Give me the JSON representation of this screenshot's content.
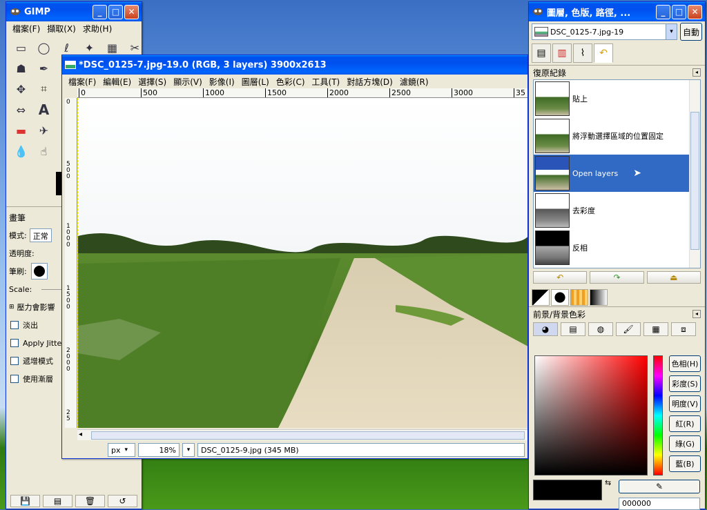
{
  "toolbox": {
    "title": "GIMP",
    "menu": [
      "檔案(F)",
      "擷取(X)",
      "求助(H)"
    ],
    "options_title": "畫筆",
    "mode_label": "模式:",
    "mode_value": "正常",
    "opacity_label": "透明度:",
    "brush_label": "筆刷:",
    "scale_label": "Scale:",
    "pressure_label": "壓力會影響",
    "fade_label": "淡出",
    "jitter_label": "Apply Jitte",
    "incremental_label": "遞增模式",
    "layer_label": "使用漸層"
  },
  "image_window": {
    "title": "*DSC_0125-7.jpg-19.0 (RGB, 3 layers) 3900x2613",
    "menu": [
      "檔案(F)",
      "編輯(E)",
      "選擇(S)",
      "顯示(V)",
      "影像(I)",
      "圖層(L)",
      "色彩(C)",
      "工具(T)",
      "對話方塊(D)",
      "濾鏡(R)"
    ],
    "ruler_ticks": [
      "0",
      "500",
      "1000",
      "1500",
      "2000",
      "2500",
      "3000",
      "35"
    ],
    "ruler_v_ticks": [
      "0",
      "5\n0\n0",
      "1\n0\n0\n0",
      "1\n5\n0\n0",
      "2\n0\n0\n0",
      "2\n5"
    ],
    "unit": "px",
    "zoom": "18%",
    "status": "DSC_0125-9.jpg (345 MB)"
  },
  "dock": {
    "title": "圖層, 色版, 路徑, ...",
    "image_name": "DSC_0125-7.jpg-19",
    "auto_label": "自動",
    "history_title": "復原紀錄",
    "history_items": [
      {
        "label": "貼上",
        "selected": false
      },
      {
        "label": "將浮動選擇區域的位置固定",
        "selected": false
      },
      {
        "label": "Open layers",
        "selected": true
      },
      {
        "label": "去彩度",
        "selected": false
      },
      {
        "label": "反相",
        "selected": false
      }
    ],
    "color_title": "前景/背景色彩",
    "channels": [
      "色相(H)",
      "彩度(S)",
      "明度(V)",
      "紅(R)",
      "綠(G)",
      "藍(B)"
    ],
    "hex_value": "000000"
  },
  "colors": {
    "selection": "#316ac5",
    "titlebar": "#0053ee"
  }
}
